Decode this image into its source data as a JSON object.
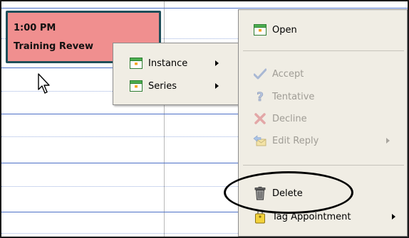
{
  "appointment": {
    "time": "1:00 PM",
    "title": "Training Revew",
    "color": "#f08f8f"
  },
  "submenu": {
    "items": [
      {
        "label": "Instance",
        "icon": "calendar-icon"
      },
      {
        "label": "Series",
        "icon": "calendar-icon"
      }
    ]
  },
  "context_menu": {
    "items": [
      {
        "label": "Open",
        "icon": "calendar-icon",
        "enabled": true
      },
      {
        "label": "Accept",
        "icon": "checkmark-icon",
        "enabled": false
      },
      {
        "label": "Tentative",
        "icon": "question-icon",
        "enabled": false
      },
      {
        "label": "Decline",
        "icon": "x-icon",
        "enabled": false
      },
      {
        "label": "Edit Reply",
        "icon": "edit-reply-icon",
        "enabled": false
      },
      {
        "label": "Delete",
        "icon": "trash-icon",
        "enabled": true
      },
      {
        "label": "Tag Appointment",
        "icon": "tag-icon",
        "enabled": true
      }
    ]
  },
  "colors": {
    "grid_line": "#4b6fc7",
    "menu_bg": "#f0ede4",
    "appointment_border": "#1f4f5a"
  }
}
